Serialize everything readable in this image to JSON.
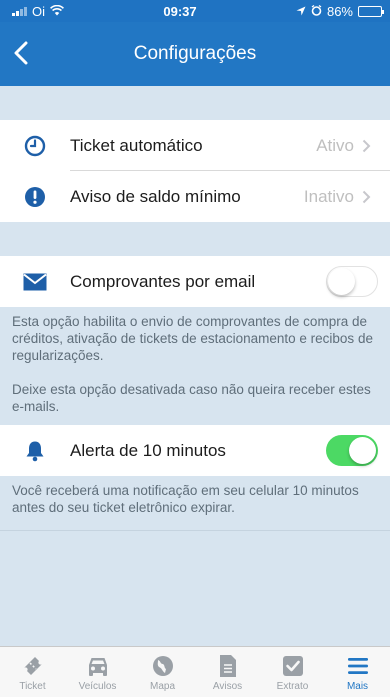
{
  "status_bar": {
    "carrier": "Oi",
    "time": "09:37",
    "battery": "86%"
  },
  "nav": {
    "title": "Configurações"
  },
  "settings": {
    "ticket_auto": {
      "label": "Ticket automático",
      "value": "Ativo"
    },
    "saldo_minimo": {
      "label": "Aviso de saldo mínimo",
      "value": "Inativo"
    },
    "email": {
      "label": "Comprovantes por email",
      "enabled": false,
      "note_1": "Esta opção habilita o envio de comprovantes de compra de créditos, ativação de tickets de estacionamento e recibos de regularizações.",
      "note_2": "Deixe esta opção desativada caso não queira receber estes e-mails."
    },
    "alerta": {
      "label": "Alerta de 10 minutos",
      "enabled": true,
      "note": "Você receberá uma notificação em seu celular 10 minutos antes do seu ticket eletrônico expirar."
    }
  },
  "tabs": [
    {
      "label": "Ticket",
      "icon": "ticket-icon"
    },
    {
      "label": "Veículos",
      "icon": "car-icon"
    },
    {
      "label": "Mapa",
      "icon": "globe-icon"
    },
    {
      "label": "Avisos",
      "icon": "document-icon"
    },
    {
      "label": "Extrato",
      "icon": "checkbox-icon"
    },
    {
      "label": "Mais",
      "icon": "menu-icon",
      "active": true
    }
  ],
  "colors": {
    "primary": "#2277c4",
    "background": "#d7e4ef",
    "toggle_on": "#4cd964",
    "tab_inactive": "#9aa0a6"
  }
}
